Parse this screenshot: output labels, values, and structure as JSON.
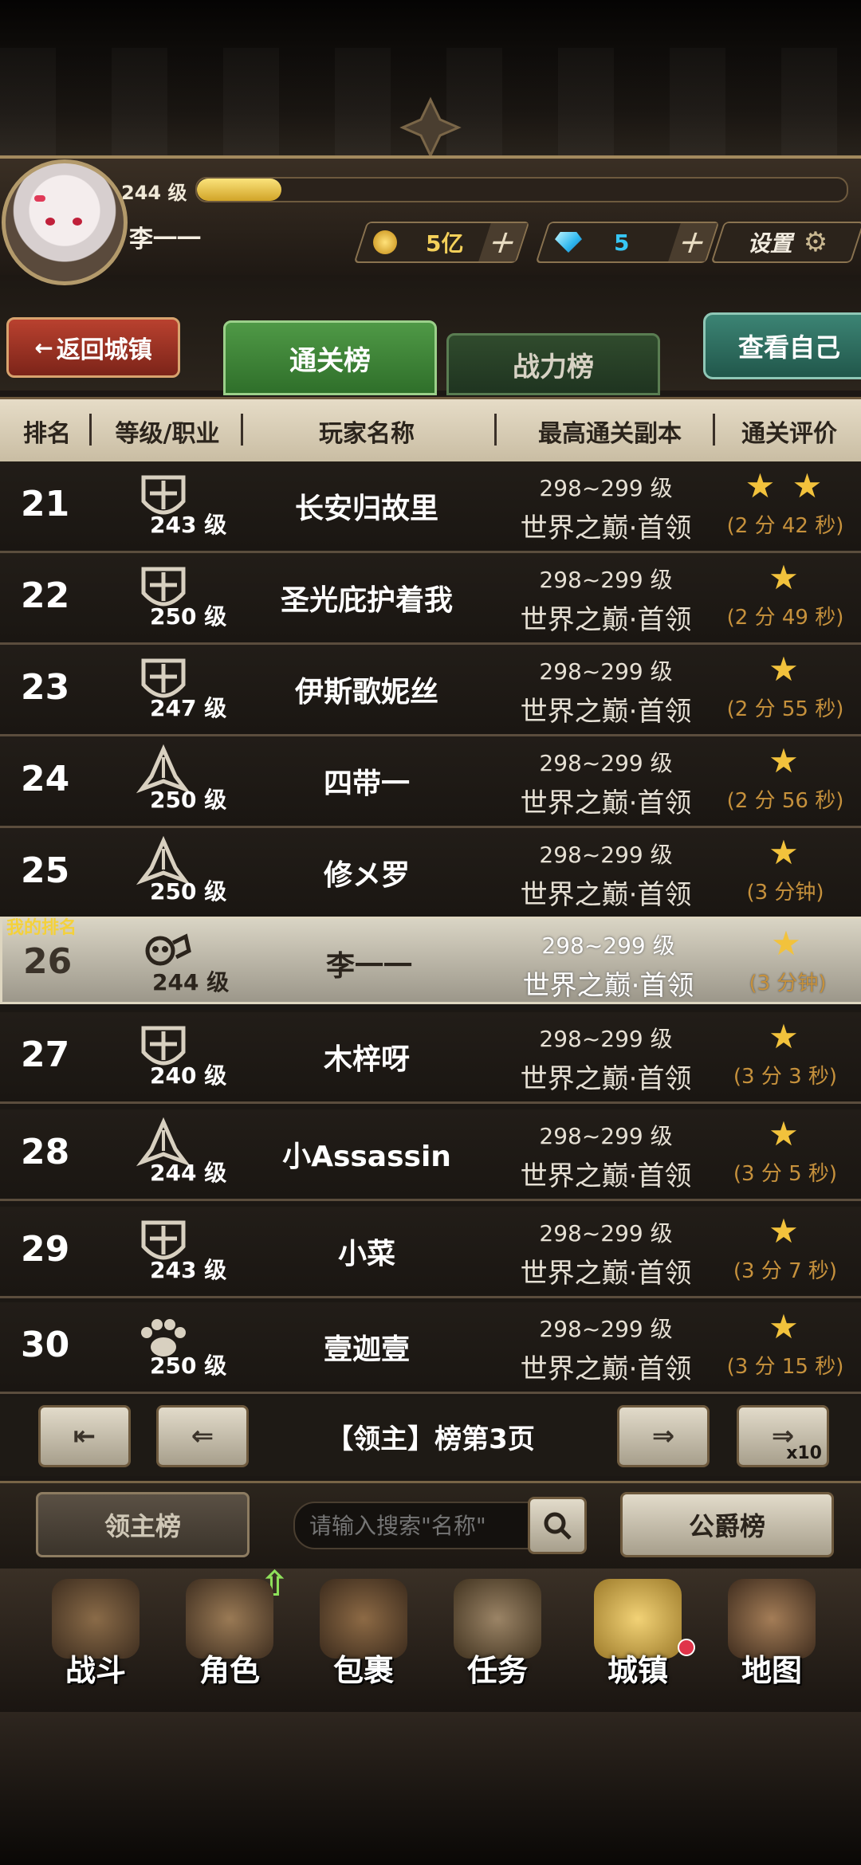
{
  "header": {
    "level": "244 级",
    "xp_fraction": 0.13,
    "player_name": "李一一",
    "gold": "5亿",
    "gems": "5",
    "settings_label": "设置"
  },
  "nav": {
    "back_label": "返回城镇",
    "tab_clear": "通关榜",
    "tab_power": "战力榜",
    "view_self": "查看自己"
  },
  "columns": {
    "rank": "排名",
    "level_class": "等级/职业",
    "player_name": "玩家名称",
    "best_stage": "最高通关副本",
    "rating": "通关评价"
  },
  "my_rank_label": "我的排名",
  "rows": [
    {
      "rank": "21",
      "level": "243 级",
      "class_icon": "shield-cross-icon",
      "name": "长安归故里",
      "range": "298~299 级",
      "stage": "世界之巅·首领",
      "stars": "★ ★",
      "time": "(2 分 42 秒)"
    },
    {
      "rank": "22",
      "level": "250 级",
      "class_icon": "shield-cross-icon",
      "name": "圣光庇护着我",
      "range": "298~299 级",
      "stage": "世界之巅·首领",
      "stars": "★",
      "time": "(2 分 49 秒)"
    },
    {
      "rank": "23",
      "level": "247 级",
      "class_icon": "shield-cross-icon",
      "name": "伊斯歌妮丝",
      "range": "298~299 级",
      "stage": "世界之巅·首领",
      "stars": "★",
      "time": "(2 分 55 秒)"
    },
    {
      "rank": "24",
      "level": "250 级",
      "class_icon": "flame-blade-icon",
      "name": "四带一",
      "range": "298~299 级",
      "stage": "世界之巅·首领",
      "stars": "★",
      "time": "(2 分 56 秒)"
    },
    {
      "rank": "25",
      "level": "250 级",
      "class_icon": "flame-blade-icon",
      "name": "修メ罗",
      "range": "298~299 级",
      "stage": "世界之巅·首领",
      "stars": "★",
      "time": "(3 分钟)"
    },
    {
      "rank": "26",
      "level": "244 级",
      "class_icon": "skull-fist-icon",
      "name": "李一一",
      "range": "298~299 级",
      "stage": "世界之巅·首领",
      "stars": "★",
      "time": "(3 分钟)"
    },
    {
      "rank": "27",
      "level": "240 级",
      "class_icon": "shield-cross-icon",
      "name": "木梓呀",
      "range": "298~299 级",
      "stage": "世界之巅·首领",
      "stars": "★",
      "time": "(3 分 3 秒)"
    },
    {
      "rank": "28",
      "level": "244 级",
      "class_icon": "flame-blade-icon",
      "name": "小Assassin",
      "range": "298~299 级",
      "stage": "世界之巅·首领",
      "stars": "★",
      "time": "(3 分 5 秒)"
    },
    {
      "rank": "29",
      "level": "243 级",
      "class_icon": "shield-cross-icon",
      "name": "小菜",
      "range": "298~299 级",
      "stage": "世界之巅·首领",
      "stars": "★",
      "time": "(3 分 7 秒)"
    },
    {
      "rank": "30",
      "level": "250 级",
      "class_icon": "paw-icon",
      "name": "壹迦壹",
      "range": "298~299 级",
      "stage": "世界之巅·首领",
      "stars": "★",
      "time": "(3 分 15 秒)"
    }
  ],
  "pager": {
    "page_text": "【领主】榜第3页",
    "x10": "x10"
  },
  "search": {
    "lord_board": "领主榜",
    "placeholder": "请输入搜索\"名称\"",
    "duke_board": "公爵榜"
  },
  "bottom_nav": {
    "battle": "战斗",
    "character": "角色",
    "bag": "包裹",
    "quest": "任务",
    "town": "城镇",
    "map": "地图"
  },
  "colors": {
    "accent_green": "#4f9946",
    "back_red": "#b9412f",
    "star_gold": "#f2c23c",
    "time_orange": "#c6913c"
  }
}
